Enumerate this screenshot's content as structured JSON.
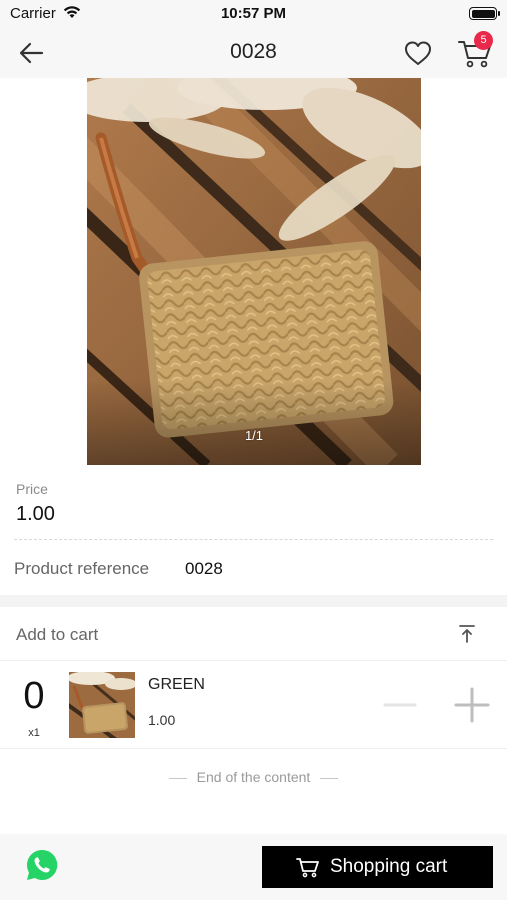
{
  "status_bar": {
    "carrier": "Carrier",
    "time": "10:57 PM",
    "icons": [
      "wifi-icon",
      "battery-icon"
    ]
  },
  "nav": {
    "title": "0028",
    "back_icon": "arrow-left-icon",
    "favorite_icon": "heart-icon",
    "cart_icon": "cart-icon",
    "cart_badge": "5",
    "badge_color": "#e8294a"
  },
  "gallery": {
    "counter": "1/1"
  },
  "product": {
    "price_label": "Price",
    "price_value": "1.00",
    "reference_label": "Product reference",
    "reference_value": "0028"
  },
  "add_to_cart": {
    "title": "Add to cart",
    "collapse_icon": "arrow-to-top-icon",
    "variants": [
      {
        "quantity": "0",
        "multiplier": "x1",
        "name": "GREEN",
        "price": "1.00"
      }
    ]
  },
  "footer": {
    "end_text": "End of the content"
  },
  "bottom_bar": {
    "whatsapp_icon": "whatsapp-icon",
    "whatsapp_color": "#25d366",
    "shopping_cart_label": "Shopping cart",
    "button_color": "#000000"
  }
}
